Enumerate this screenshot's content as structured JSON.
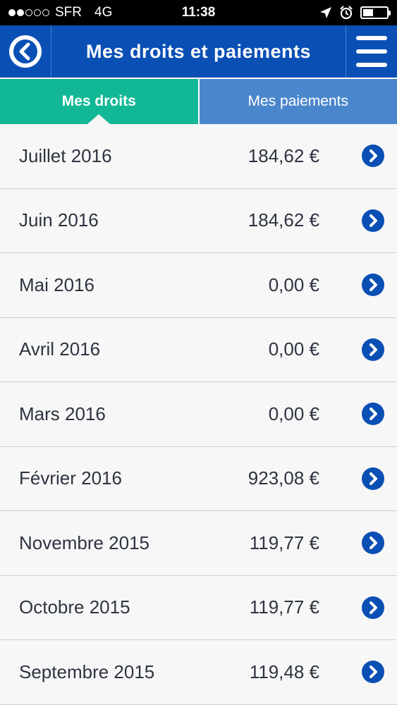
{
  "status_bar": {
    "carrier": "SFR",
    "network": "4G",
    "time": "11:38",
    "signal_strength": 2,
    "signal_total": 5,
    "battery_level": 0.45
  },
  "header": {
    "title": "Mes droits et paiements",
    "back_icon": "back-circle-icon",
    "menu_icon": "hamburger-menu-icon"
  },
  "tabs": [
    {
      "label": "Mes droits",
      "active": true
    },
    {
      "label": "Mes paiements",
      "active": false
    }
  ],
  "rows": [
    {
      "month": "Juillet 2016",
      "amount": "184,62 €"
    },
    {
      "month": "Juin 2016",
      "amount": "184,62 €"
    },
    {
      "month": "Mai 2016",
      "amount": "0,00 €"
    },
    {
      "month": "Avril 2016",
      "amount": "0,00 €"
    },
    {
      "month": "Mars 2016",
      "amount": "0,00 €"
    },
    {
      "month": "Février 2016",
      "amount": "923,08 €"
    },
    {
      "month": "Novembre 2015",
      "amount": "119,77 €"
    },
    {
      "month": "Octobre 2015",
      "amount": "119,77 €"
    },
    {
      "month": "Septembre 2015",
      "amount": "119,48 €"
    }
  ],
  "colors": {
    "header_bg": "#0a4fb4",
    "tab_active_bg": "#12b896",
    "tab_inactive_bg": "#4a86cc",
    "chevron": "#0a4fb4"
  }
}
